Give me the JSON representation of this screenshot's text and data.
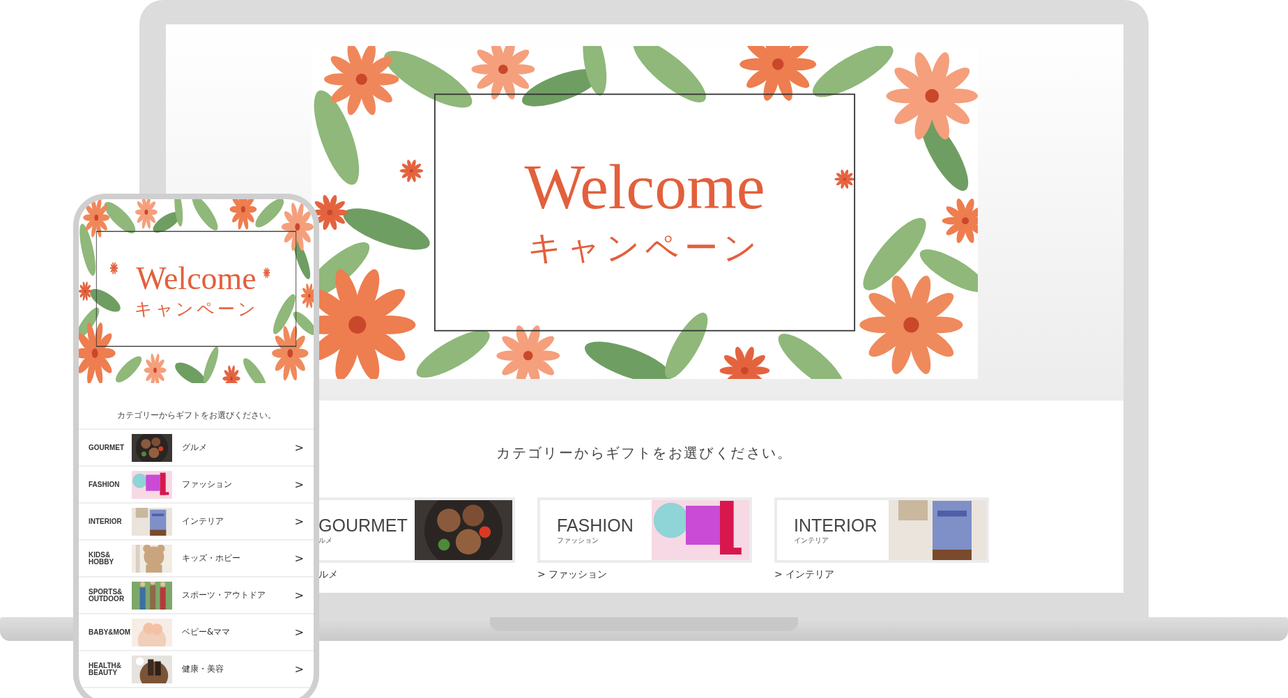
{
  "laptop": {
    "banner": {
      "title": "Welcome",
      "subtitle": "キャンペーン"
    },
    "prompt": "カテゴリーからギフトをお選びください。",
    "tiles": [
      {
        "label": "GOURMET",
        "sublabel": "ルメ",
        "caption": "ルメ"
      },
      {
        "label": "FASHION",
        "sublabel": "ファッション",
        "caption": "> ファッション"
      },
      {
        "label": "INTERIOR",
        "sublabel": "インテリア",
        "caption": "> インテリア"
      }
    ]
  },
  "phone": {
    "banner": {
      "title": "Welcome",
      "subtitle": "キャンペーン"
    },
    "prompt": "カテゴリーからギフトをお選びください。",
    "categories": [
      {
        "label": [
          "GOURMET"
        ],
        "name": "グルメ",
        "chevron": ">"
      },
      {
        "label": [
          "FASHION"
        ],
        "name": "ファッション",
        "chevron": ">"
      },
      {
        "label": [
          "INTERIOR"
        ],
        "name": "インテリア",
        "chevron": ">"
      },
      {
        "label": [
          "KIDS&",
          "HOBBY"
        ],
        "name": "キッズ・ホビー",
        "chevron": ">"
      },
      {
        "label": [
          "SPORTS&",
          "OUTDOOR"
        ],
        "name": "スポーツ・アウトドア",
        "chevron": ">"
      },
      {
        "label": [
          "BABY&MOM"
        ],
        "name": "ベビー&ママ",
        "chevron": ">"
      },
      {
        "label": [
          "HEALTH&",
          "BEAUTY"
        ],
        "name": "健康・美容",
        "chevron": ">"
      }
    ]
  }
}
